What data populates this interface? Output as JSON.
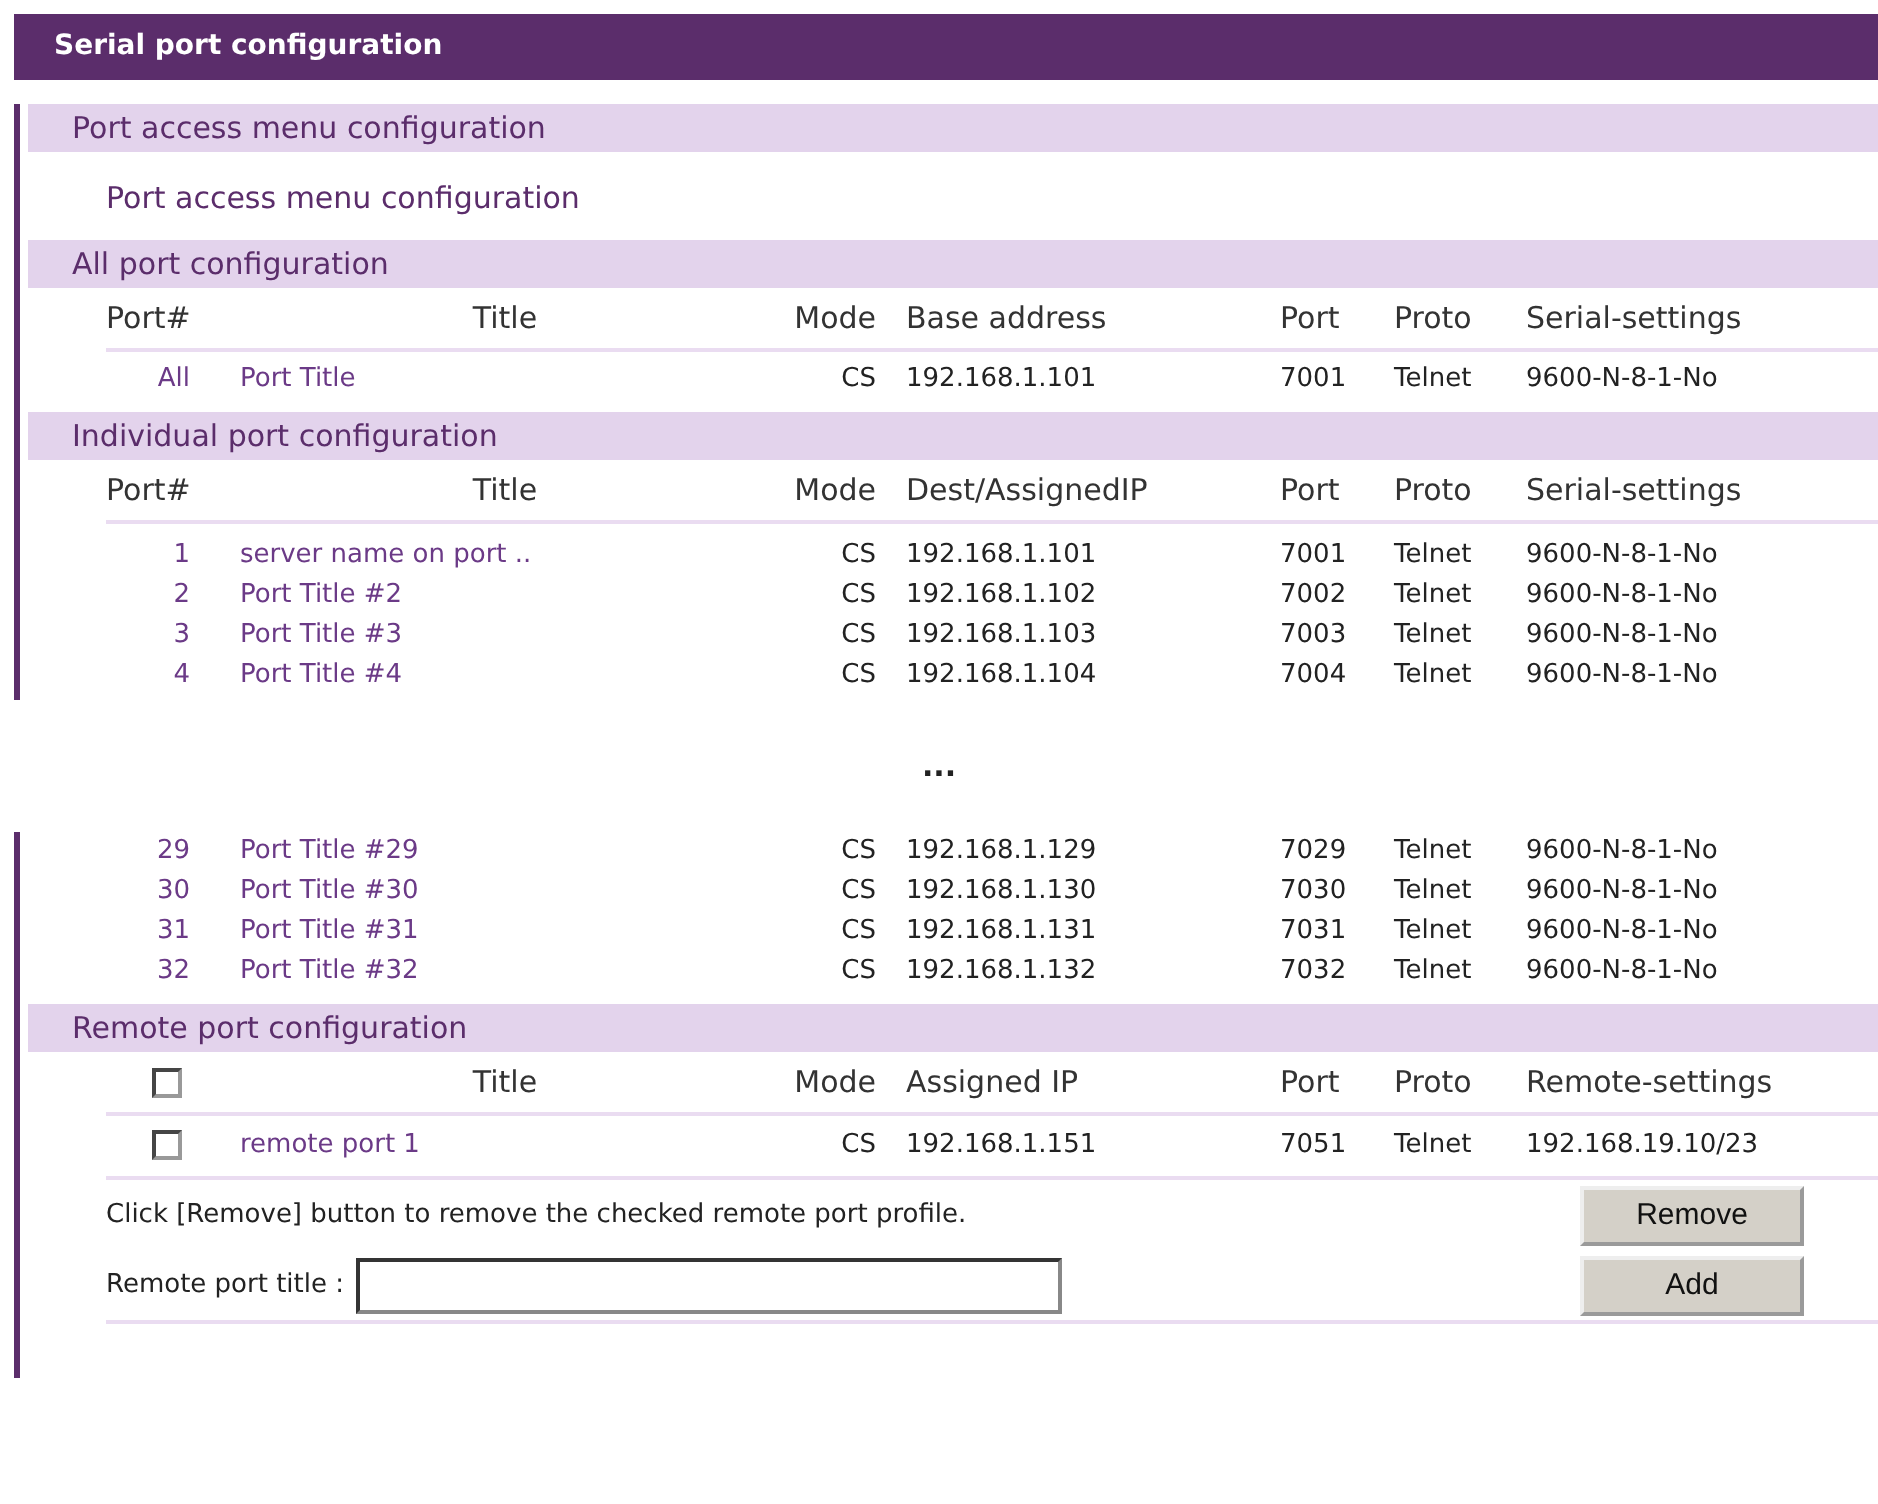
{
  "header": {
    "title": "Serial port configuration"
  },
  "port_access": {
    "heading": "Port access menu configuration",
    "link": "Port access menu configuration"
  },
  "all_ports": {
    "heading": "All port configuration",
    "columns": [
      "Port#",
      "Title",
      "Mode",
      "Base address",
      "Port",
      "Proto",
      "Serial-settings"
    ],
    "rows": [
      {
        "port": "All",
        "title": "Port Title",
        "mode": "CS",
        "address": "192.168.1.101",
        "tcp_port": "7001",
        "proto": "Telnet",
        "settings": "9600-N-8-1-No"
      }
    ]
  },
  "individual_ports": {
    "heading": "Individual port configuration",
    "columns": [
      "Port#",
      "Title",
      "Mode",
      "Dest/AssignedIP",
      "Port",
      "Proto",
      "Serial-settings"
    ],
    "rows": [
      {
        "port": "1",
        "title": "server name on port ..",
        "mode": "CS",
        "address": "192.168.1.101",
        "tcp_port": "7001",
        "proto": "Telnet",
        "settings": "9600-N-8-1-No"
      },
      {
        "port": "2",
        "title": "Port Title #2",
        "mode": "CS",
        "address": "192.168.1.102",
        "tcp_port": "7002",
        "proto": "Telnet",
        "settings": "9600-N-8-1-No"
      },
      {
        "port": "3",
        "title": "Port Title #3",
        "mode": "CS",
        "address": "192.168.1.103",
        "tcp_port": "7003",
        "proto": "Telnet",
        "settings": "9600-N-8-1-No"
      },
      {
        "port": "4",
        "title": "Port Title #4",
        "mode": "CS",
        "address": "192.168.1.104",
        "tcp_port": "7004",
        "proto": "Telnet",
        "settings": "9600-N-8-1-No"
      }
    ],
    "ellipsis": "...",
    "rows_after": [
      {
        "port": "29",
        "title": "Port Title #29",
        "mode": "CS",
        "address": "192.168.1.129",
        "tcp_port": "7029",
        "proto": "Telnet",
        "settings": "9600-N-8-1-No"
      },
      {
        "port": "30",
        "title": "Port Title #30",
        "mode": "CS",
        "address": "192.168.1.130",
        "tcp_port": "7030",
        "proto": "Telnet",
        "settings": "9600-N-8-1-No"
      },
      {
        "port": "31",
        "title": "Port Title #31",
        "mode": "CS",
        "address": "192.168.1.131",
        "tcp_port": "7031",
        "proto": "Telnet",
        "settings": "9600-N-8-1-No"
      },
      {
        "port": "32",
        "title": "Port Title #32",
        "mode": "CS",
        "address": "192.168.1.132",
        "tcp_port": "7032",
        "proto": "Telnet",
        "settings": "9600-N-8-1-No"
      }
    ]
  },
  "remote_ports": {
    "heading": "Remote port configuration",
    "select_all_checked": false,
    "columns": [
      "Title",
      "Mode",
      "Assigned IP",
      "Port",
      "Proto",
      "Remote-settings"
    ],
    "rows": [
      {
        "checked": false,
        "title": "remote port 1",
        "mode": "CS",
        "address": "192.168.1.151",
        "tcp_port": "7051",
        "proto": "Telnet",
        "settings": "192.168.19.10/23"
      }
    ],
    "note": "Click [Remove] button to remove the checked remote port profile.",
    "title_field": {
      "label": "Remote port title :"
    },
    "buttons": [
      "Remove",
      "Add"
    ]
  }
}
